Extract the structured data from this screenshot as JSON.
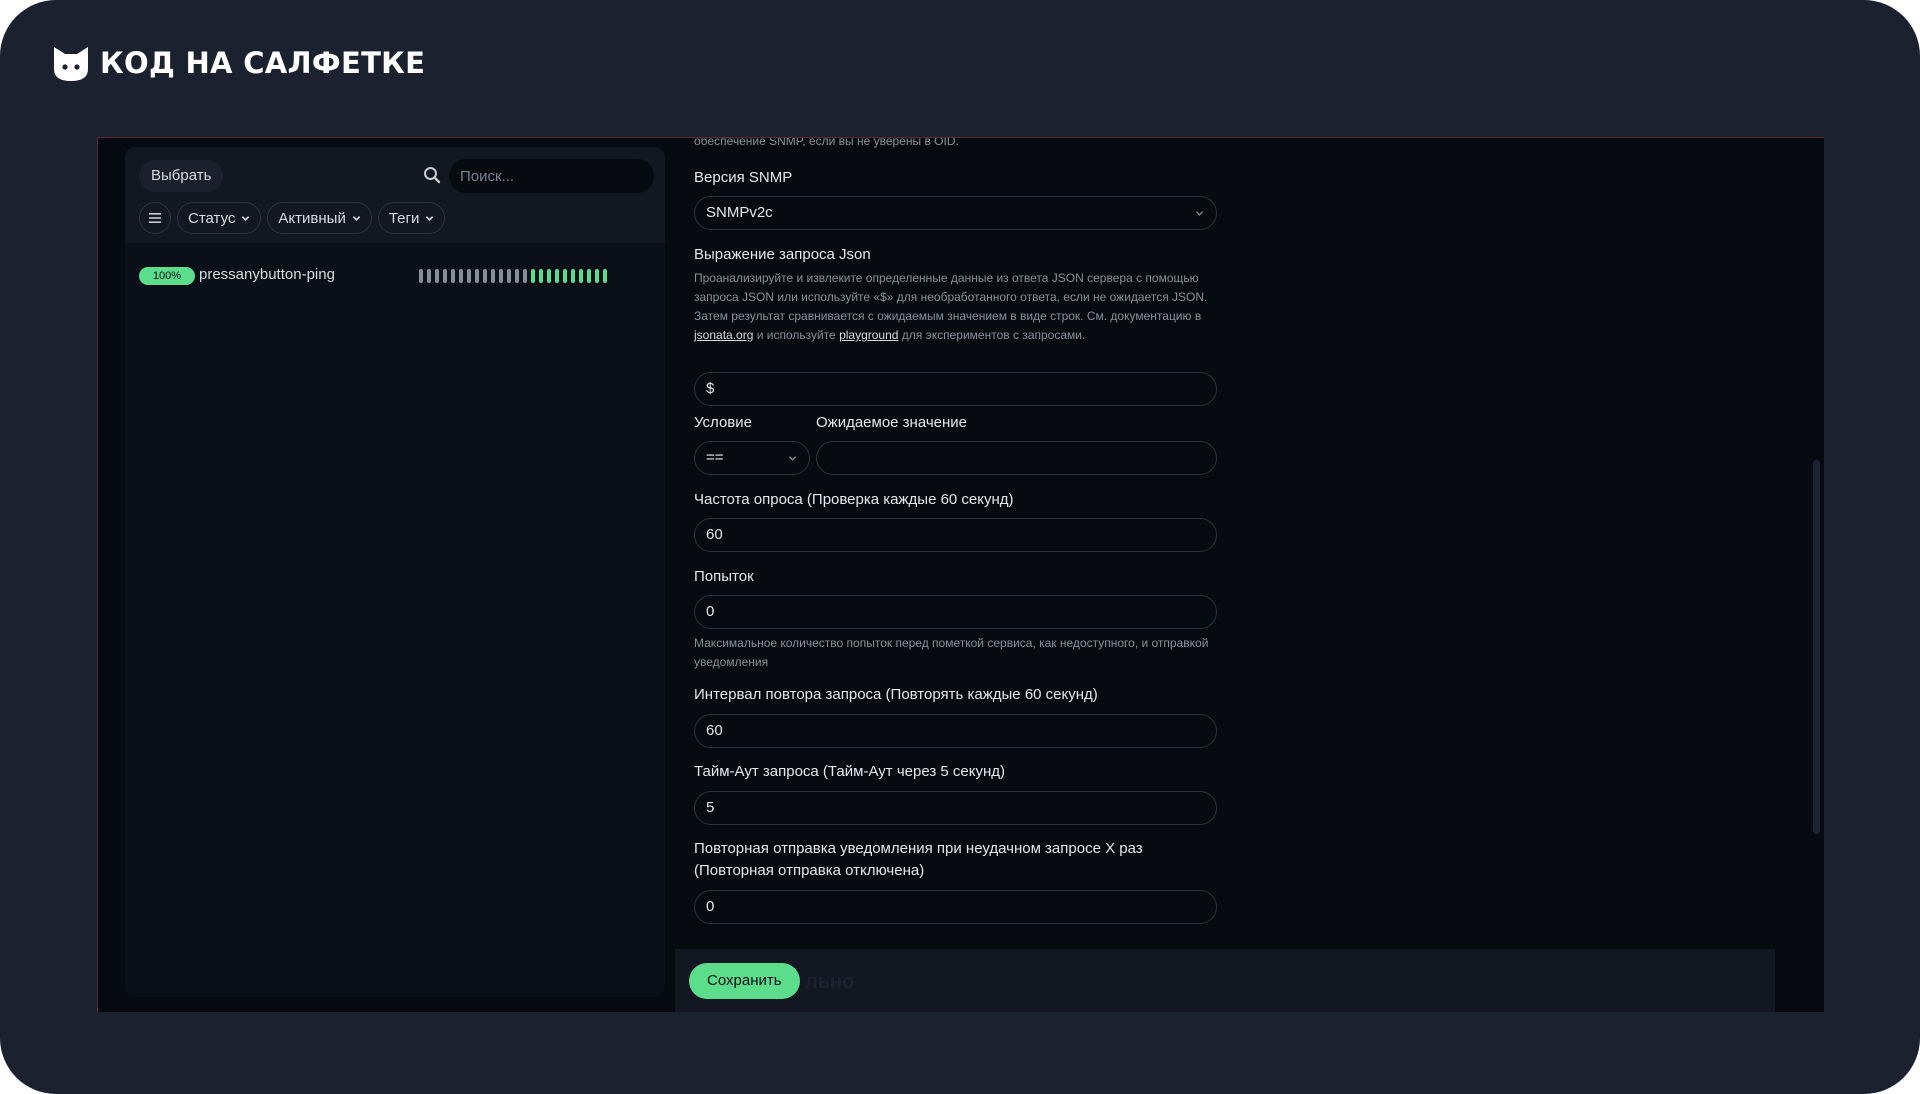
{
  "brand": {
    "name": "КОД НА САЛФЕТКЕ",
    "logo": "cat-head-icon"
  },
  "list_panel": {
    "select_label": "Выбрать",
    "search_placeholder": "Поиск...",
    "filters": [
      "Статус",
      "Активный",
      "Теги"
    ],
    "monitor": {
      "uptime_badge": "100%",
      "name": "pressanybutton-ping",
      "heartbeats": {
        "pending_count": 14,
        "up_count": 10,
        "colors": {
          "pending": "#8a8f99",
          "up": "#5cdd8b"
        }
      }
    }
  },
  "form": {
    "top_hint": "обеспечение SNMP, если вы не уверены в OID.",
    "snmp_version": {
      "label": "Версия SNMP",
      "value": "SNMPv2c"
    },
    "json_query": {
      "label": "Выражение запроса Json",
      "hint_part1": "Проанализируйте и извлеките определенные данные из ответа JSON сервера с помощью запроса JSON или используйте «$» для необработанного ответа, если не ожидается JSON. Затем результат сравнивается с ожидаемым значением в виде строк. См. документацию в ",
      "hint_link1": "jsonata.org",
      "hint_part2": " и используйте ",
      "hint_link2": "playground",
      "hint_part3": " для экспериментов с запросами.",
      "value": "$"
    },
    "condition": {
      "label": "Условие",
      "value": "=="
    },
    "expected_value": {
      "label": "Ожидаемое значение",
      "value": ""
    },
    "interval": {
      "label": "Частота опроса (Проверка каждые 60 секунд)",
      "value": "60"
    },
    "retries": {
      "label": "Попыток",
      "value": "0",
      "hint": "Максимальное количество попыток перед пометкой сервиса, как недоступного, и отправкой уведомления"
    },
    "retry_interval": {
      "label": "Интервал повтора запроса (Повторять каждые 60 секунд)",
      "value": "60"
    },
    "timeout": {
      "label": "Тайм-Аут запроса (Тайм-Аут через 5 секунд)",
      "value": "5"
    },
    "resend": {
      "label": "Повторная отправка уведомления при неудачном запросе X раз (Повторная отправка отключена)",
      "value": "0"
    },
    "save_label": "Сохранить",
    "ghost_label": "льно"
  },
  "colors": {
    "accent": "#5cdd8b",
    "frame": "#1c2130",
    "app_bg": "#070a11"
  }
}
